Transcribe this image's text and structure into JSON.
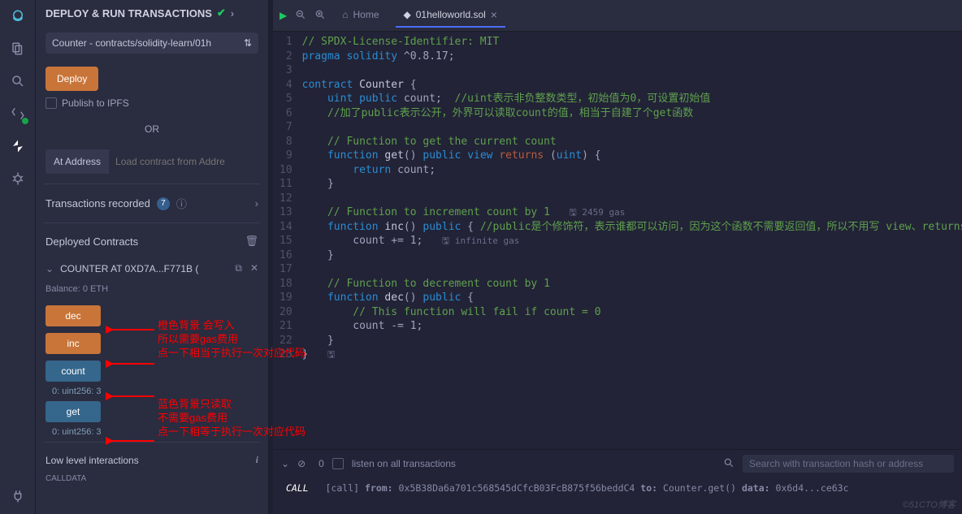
{
  "iconbar": {
    "logo": "remix-logo",
    "items": [
      "files",
      "search",
      "swap",
      "deploy",
      "bug"
    ],
    "bottom": "plug"
  },
  "panel": {
    "title": "DEPLOY & RUN TRANSACTIONS",
    "contractSelect": "Counter - contracts/solidity-learn/01h",
    "deploy": "Deploy",
    "publish": "Publish to IPFS",
    "or": "OR",
    "atAddress": "At Address",
    "atAddressPlaceholder": "Load contract from Addre",
    "txRecorded": "Transactions recorded",
    "txCount": "7",
    "deployedContracts": "Deployed Contracts",
    "contractName": "COUNTER AT 0XD7A...F771B (",
    "balance": "Balance: 0 ETH",
    "fns": {
      "dec": "dec",
      "inc": "inc",
      "count": "count",
      "get": "get"
    },
    "output1": "0: uint256: 3",
    "output2": "0: uint256: 3",
    "lowLevel": "Low level interactions",
    "calldata": "CALLDATA"
  },
  "tabs": {
    "home": "Home",
    "file": "01helloworld.sol"
  },
  "code": [
    {
      "n": 1,
      "html": "<span class='cmt'>// SPDX-License-Identifier: MIT</span>"
    },
    {
      "n": 2,
      "html": "<span class='kw'>pragma</span> <span class='kw'>solidity</span> ^0.8.17;"
    },
    {
      "n": 3,
      "html": ""
    },
    {
      "n": 4,
      "html": "<span class='kw'>contract</span> <span class='fn'>Counter</span> {"
    },
    {
      "n": 5,
      "html": "    <span class='type'>uint</span> <span class='kw'>public</span> count;  <span class='cmt'>//uint表示非负整数类型，初始值为0，可设置初始值</span>"
    },
    {
      "n": 6,
      "html": "    <span class='cmt'>//加了public表示公开，外界可以读取count的值，相当于自建了个get函数</span>"
    },
    {
      "n": 7,
      "html": ""
    },
    {
      "n": 8,
      "html": "    <span class='cmt'>// Function to get the current count</span>"
    },
    {
      "n": 9,
      "html": "    <span class='kw'>function</span> <span class='fn'>get</span>() <span class='kw'>public</span> <span class='kw'>view</span> <span class='ret'>returns</span> (<span class='type'>uint</span>) {"
    },
    {
      "n": 10,
      "html": "        <span class='kw'>return</span> count;"
    },
    {
      "n": 11,
      "html": "    }"
    },
    {
      "n": 12,
      "html": ""
    },
    {
      "n": 13,
      "html": "    <span class='cmt'>// Function to increment count by 1</span>   <span class='gas-hint'>🖫 2459 gas</span>"
    },
    {
      "n": 14,
      "html": "    <span class='kw'>function</span> <span class='fn'>inc</span>() <span class='kw'>public</span> { <span class='cmt'>//public是个修饰符，表示谁都可以访问，因为这个函数不需要返回值，所以不用写 view、returns</span>"
    },
    {
      "n": 15,
      "html": "        count += 1;   <span class='gas-hint'>🖫 infinite gas</span>"
    },
    {
      "n": 16,
      "html": "    }"
    },
    {
      "n": 17,
      "html": ""
    },
    {
      "n": 18,
      "html": "    <span class='cmt'>// Function to decrement count by 1</span>"
    },
    {
      "n": 19,
      "html": "    <span class='kw'>function</span> <span class='fn'>dec</span>() <span class='kw'>public</span> {"
    },
    {
      "n": 20,
      "html": "        <span class='cmt'>// This function will fail if count = 0</span>"
    },
    {
      "n": 21,
      "html": "        count -= 1;"
    },
    {
      "n": 22,
      "html": "    }"
    },
    {
      "n": 23,
      "html": "}   <span class='gas-hint'>🖫</span>"
    }
  ],
  "terminal": {
    "listen": "listen on all transactions",
    "searchPlaceholder": "Search with transaction hash or address",
    "log": {
      "prefix": "CALL",
      "bracket": "[call]",
      "fromLabel": "from:",
      "from": "0x5B38Da6a701c568545dCfcB03FcB875f56beddC4",
      "toLabel": "to:",
      "to": "Counter.get()",
      "dataLabel": "data:",
      "data": "0x6d4...ce63c"
    }
  },
  "annotations": {
    "a1l1": "橙色背景 会写入",
    "a1l2": "所以需要gas费用",
    "a1l3": "点一下相当于执行一次对应代码",
    "a2l1": "蓝色背景只读取",
    "a2l2": "不需要gas费用",
    "a2l3": "点一下相等于执行一次对应代码"
  },
  "watermark": "©51CTO博客"
}
